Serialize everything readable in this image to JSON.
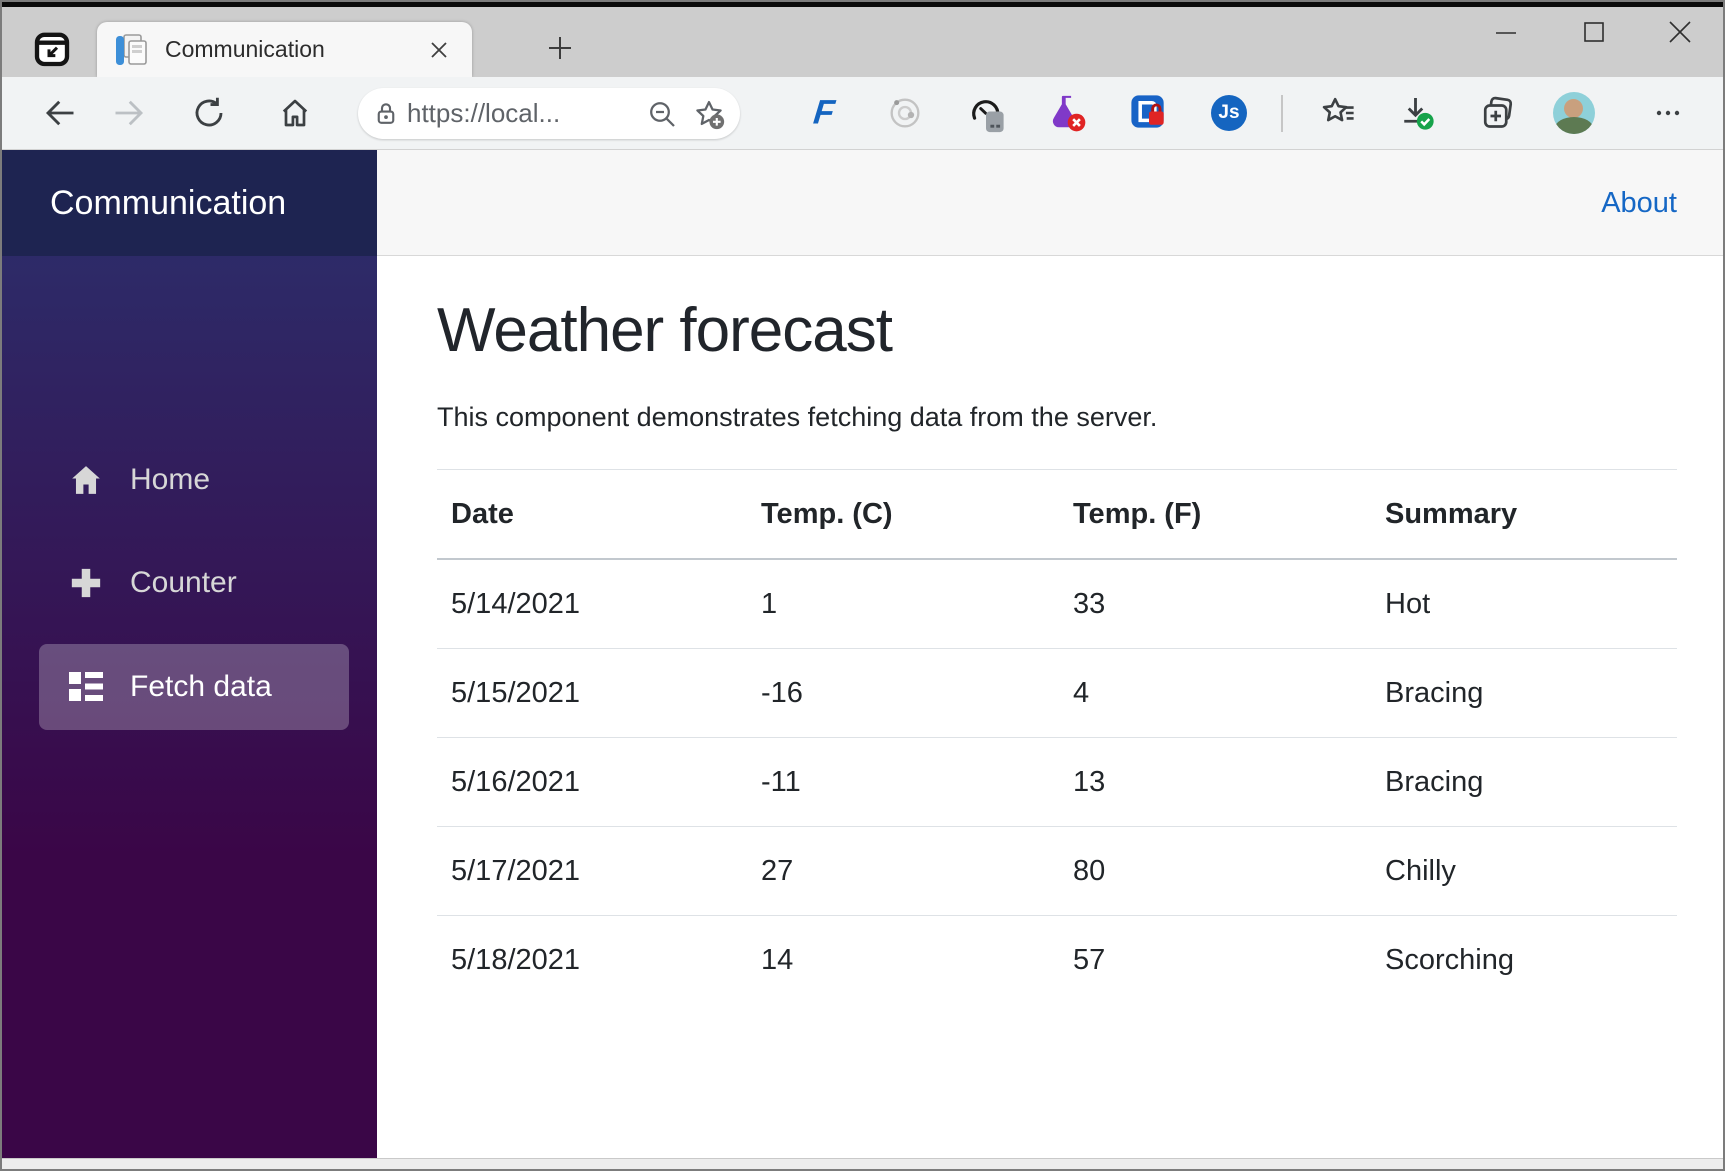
{
  "browser": {
    "tab": {
      "title": "Communication"
    },
    "address_bar": {
      "url": "https://local..."
    },
    "extensions": {
      "fiddler_label": "F",
      "json_viewer_label": "Js"
    }
  },
  "app": {
    "sidebar": {
      "brand": "Communication",
      "items": [
        {
          "label": "Home",
          "icon": "home-icon"
        },
        {
          "label": "Counter",
          "icon": "plus-icon"
        },
        {
          "label": "Fetch data",
          "icon": "list-rich-icon"
        }
      ],
      "active_item": "Fetch data"
    },
    "header": {
      "about_label": "About"
    },
    "main": {
      "title": "Weather forecast",
      "description": "This component demonstrates fetching data from the server.",
      "table": {
        "headers": [
          "Date",
          "Temp. (C)",
          "Temp. (F)",
          "Summary"
        ],
        "rows": [
          [
            "5/14/2021",
            "1",
            "33",
            "Hot"
          ],
          [
            "5/15/2021",
            "-16",
            "4",
            "Bracing"
          ],
          [
            "5/16/2021",
            "-11",
            "13",
            "Bracing"
          ],
          [
            "5/17/2021",
            "27",
            "80",
            "Chilly"
          ],
          [
            "5/18/2021",
            "14",
            "57",
            "Scorching"
          ]
        ]
      }
    }
  },
  "colors": {
    "sidebar_gradient_top": "#2b316e",
    "sidebar_gradient_bottom": "#3a0647",
    "brand_band": "#1e2451",
    "active_nav_bg": "rgba(255,255,255,0.25)",
    "link_blue": "#1567c5",
    "table_border": "#dee2e6",
    "chrome_tabbar": "#cdcdcd",
    "chrome_navrow": "#f1f3f4"
  }
}
